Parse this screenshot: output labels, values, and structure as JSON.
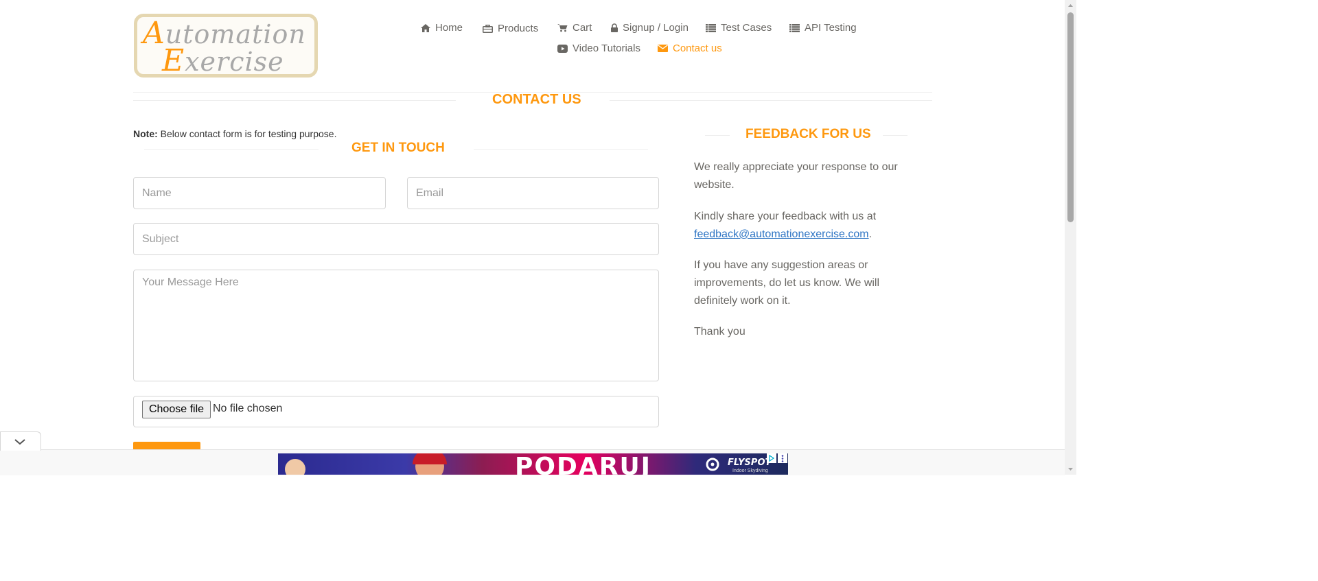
{
  "logo": {
    "line1_cap": "A",
    "line1_rest": "utomation",
    "line2_cap": "E",
    "line2_rest": "xercise"
  },
  "nav": {
    "items": [
      {
        "label": "Home",
        "icon": "home-icon"
      },
      {
        "label": "Products",
        "icon": "briefcase-icon"
      },
      {
        "label": "Cart",
        "icon": "shopping-cart-icon"
      },
      {
        "label": "Signup / Login",
        "icon": "lock-icon"
      },
      {
        "label": "Test Cases",
        "icon": "list-icon"
      },
      {
        "label": "API Testing",
        "icon": "list-icon"
      },
      {
        "label": "Video Tutorials",
        "icon": "youtube-play-icon"
      },
      {
        "label": "Contact us",
        "icon": "envelope-icon",
        "active": true
      }
    ]
  },
  "page": {
    "title": "Contact Us"
  },
  "form": {
    "note_bold": "Note:",
    "note_text": " Below contact form is for testing purpose.",
    "heading": "Get In Touch",
    "name_placeholder": "Name",
    "email_placeholder": "Email",
    "subject_placeholder": "Subject",
    "message_placeholder": "Your Message Here",
    "file_button": "Choose file",
    "file_status": "No file chosen"
  },
  "feedback": {
    "heading": "Feedback For Us",
    "p1": "We really appreciate your response to our website.",
    "p2_before": "Kindly share your feedback with us at ",
    "p2_link": "feedback@automationexercise.com",
    "p2_after": ".",
    "p3": "If you have any suggestion areas or improvements, do let us know. We will definitely work on it.",
    "p4": "Thank you"
  },
  "ad": {
    "title": "PODARUJ",
    "brand": "FLYSPOT",
    "brand_sub": "Indoor Skydiving"
  },
  "colors": {
    "accent": "#fe980f",
    "text": "#696763",
    "link": "#2f75c4"
  }
}
